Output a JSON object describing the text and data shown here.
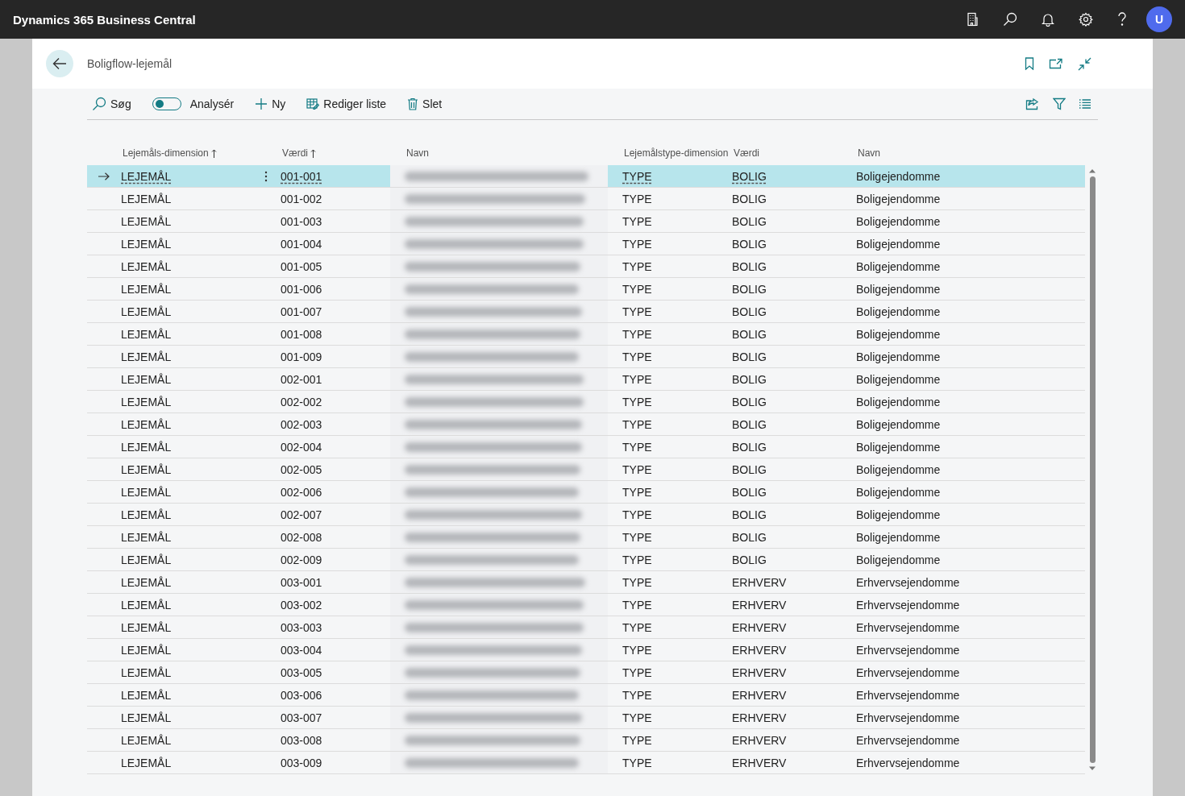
{
  "app": {
    "title": "Dynamics 365 Business Central",
    "avatar": "U"
  },
  "page": {
    "title": "Boligflow-lejemål"
  },
  "toolbar": {
    "search": "Søg",
    "analyze": {
      "label": "Analysér",
      "on": false
    },
    "actions": [
      {
        "kind": "new",
        "label": "Ny"
      },
      {
        "kind": "edit",
        "label": "Rediger liste"
      },
      {
        "kind": "delete",
        "label": "Slet"
      }
    ]
  },
  "table": {
    "columns": [
      {
        "label": "Lejemåls-dimension",
        "sorted": true
      },
      {
        "label": "Værdi",
        "sorted": true
      },
      {
        "label": "Navn",
        "sorted": false
      },
      {
        "label": "Lejemålstype-dimension",
        "sorted": false
      },
      {
        "label": "Værdi",
        "sorted": false
      },
      {
        "label": "Navn",
        "sorted": false
      }
    ],
    "rows": [
      {
        "dimension": "LEJEMÅL",
        "value": "001-001",
        "type_dimension": "TYPE",
        "type_value": "BOLIG",
        "type_name": "Boligejendomme",
        "selected": true
      },
      {
        "dimension": "LEJEMÅL",
        "value": "001-002",
        "type_dimension": "TYPE",
        "type_value": "BOLIG",
        "type_name": "Boligejendomme",
        "selected": false
      },
      {
        "dimension": "LEJEMÅL",
        "value": "001-003",
        "type_dimension": "TYPE",
        "type_value": "BOLIG",
        "type_name": "Boligejendomme",
        "selected": false
      },
      {
        "dimension": "LEJEMÅL",
        "value": "001-004",
        "type_dimension": "TYPE",
        "type_value": "BOLIG",
        "type_name": "Boligejendomme",
        "selected": false
      },
      {
        "dimension": "LEJEMÅL",
        "value": "001-005",
        "type_dimension": "TYPE",
        "type_value": "BOLIG",
        "type_name": "Boligejendomme",
        "selected": false
      },
      {
        "dimension": "LEJEMÅL",
        "value": "001-006",
        "type_dimension": "TYPE",
        "type_value": "BOLIG",
        "type_name": "Boligejendomme",
        "selected": false
      },
      {
        "dimension": "LEJEMÅL",
        "value": "001-007",
        "type_dimension": "TYPE",
        "type_value": "BOLIG",
        "type_name": "Boligejendomme",
        "selected": false
      },
      {
        "dimension": "LEJEMÅL",
        "value": "001-008",
        "type_dimension": "TYPE",
        "type_value": "BOLIG",
        "type_name": "Boligejendomme",
        "selected": false
      },
      {
        "dimension": "LEJEMÅL",
        "value": "001-009",
        "type_dimension": "TYPE",
        "type_value": "BOLIG",
        "type_name": "Boligejendomme",
        "selected": false
      },
      {
        "dimension": "LEJEMÅL",
        "value": "002-001",
        "type_dimension": "TYPE",
        "type_value": "BOLIG",
        "type_name": "Boligejendomme",
        "selected": false
      },
      {
        "dimension": "LEJEMÅL",
        "value": "002-002",
        "type_dimension": "TYPE",
        "type_value": "BOLIG",
        "type_name": "Boligejendomme",
        "selected": false
      },
      {
        "dimension": "LEJEMÅL",
        "value": "002-003",
        "type_dimension": "TYPE",
        "type_value": "BOLIG",
        "type_name": "Boligejendomme",
        "selected": false
      },
      {
        "dimension": "LEJEMÅL",
        "value": "002-004",
        "type_dimension": "TYPE",
        "type_value": "BOLIG",
        "type_name": "Boligejendomme",
        "selected": false
      },
      {
        "dimension": "LEJEMÅL",
        "value": "002-005",
        "type_dimension": "TYPE",
        "type_value": "BOLIG",
        "type_name": "Boligejendomme",
        "selected": false
      },
      {
        "dimension": "LEJEMÅL",
        "value": "002-006",
        "type_dimension": "TYPE",
        "type_value": "BOLIG",
        "type_name": "Boligejendomme",
        "selected": false
      },
      {
        "dimension": "LEJEMÅL",
        "value": "002-007",
        "type_dimension": "TYPE",
        "type_value": "BOLIG",
        "type_name": "Boligejendomme",
        "selected": false
      },
      {
        "dimension": "LEJEMÅL",
        "value": "002-008",
        "type_dimension": "TYPE",
        "type_value": "BOLIG",
        "type_name": "Boligejendomme",
        "selected": false
      },
      {
        "dimension": "LEJEMÅL",
        "value": "002-009",
        "type_dimension": "TYPE",
        "type_value": "BOLIG",
        "type_name": "Boligejendomme",
        "selected": false
      },
      {
        "dimension": "LEJEMÅL",
        "value": "003-001",
        "type_dimension": "TYPE",
        "type_value": "ERHVERV",
        "type_name": "Erhvervsejendomme",
        "selected": false
      },
      {
        "dimension": "LEJEMÅL",
        "value": "003-002",
        "type_dimension": "TYPE",
        "type_value": "ERHVERV",
        "type_name": "Erhvervsejendomme",
        "selected": false
      },
      {
        "dimension": "LEJEMÅL",
        "value": "003-003",
        "type_dimension": "TYPE",
        "type_value": "ERHVERV",
        "type_name": "Erhvervsejendomme",
        "selected": false
      },
      {
        "dimension": "LEJEMÅL",
        "value": "003-004",
        "type_dimension": "TYPE",
        "type_value": "ERHVERV",
        "type_name": "Erhvervsejendomme",
        "selected": false
      },
      {
        "dimension": "LEJEMÅL",
        "value": "003-005",
        "type_dimension": "TYPE",
        "type_value": "ERHVERV",
        "type_name": "Erhvervsejendomme",
        "selected": false
      },
      {
        "dimension": "LEJEMÅL",
        "value": "003-006",
        "type_dimension": "TYPE",
        "type_value": "ERHVERV",
        "type_name": "Erhvervsejendomme",
        "selected": false
      },
      {
        "dimension": "LEJEMÅL",
        "value": "003-007",
        "type_dimension": "TYPE",
        "type_value": "ERHVERV",
        "type_name": "Erhvervsejendomme",
        "selected": false
      },
      {
        "dimension": "LEJEMÅL",
        "value": "003-008",
        "type_dimension": "TYPE",
        "type_value": "ERHVERV",
        "type_name": "Erhvervsejendomme",
        "selected": false
      },
      {
        "dimension": "LEJEMÅL",
        "value": "003-009",
        "type_dimension": "TYPE",
        "type_value": "ERHVERV",
        "type_name": "Erhvervsejendomme",
        "selected": false
      }
    ]
  }
}
